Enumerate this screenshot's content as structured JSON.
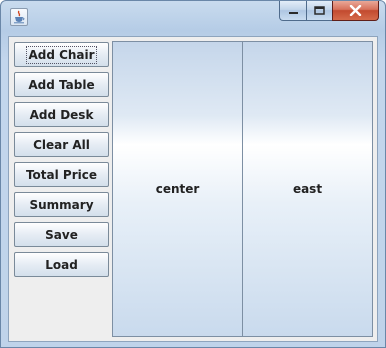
{
  "window": {
    "title": "",
    "icon": "java-cup-icon",
    "controls": {
      "minimize": "minimize-icon",
      "maximize": "maximize-icon",
      "close": "close-icon"
    }
  },
  "buttons": [
    {
      "id": "add-chair",
      "label": "Add Chair",
      "focused": true
    },
    {
      "id": "add-table",
      "label": "Add Table"
    },
    {
      "id": "add-desk",
      "label": "Add Desk"
    },
    {
      "id": "clear-all",
      "label": "Clear All"
    },
    {
      "id": "total-price",
      "label": "Total Price"
    },
    {
      "id": "summary",
      "label": "Summary"
    },
    {
      "id": "save",
      "label": "Save"
    },
    {
      "id": "load",
      "label": "Load"
    }
  ],
  "panels": {
    "center": "center",
    "east": "east"
  },
  "colors": {
    "close_button": "#c24a2f",
    "frame": "#bfd3ea"
  }
}
